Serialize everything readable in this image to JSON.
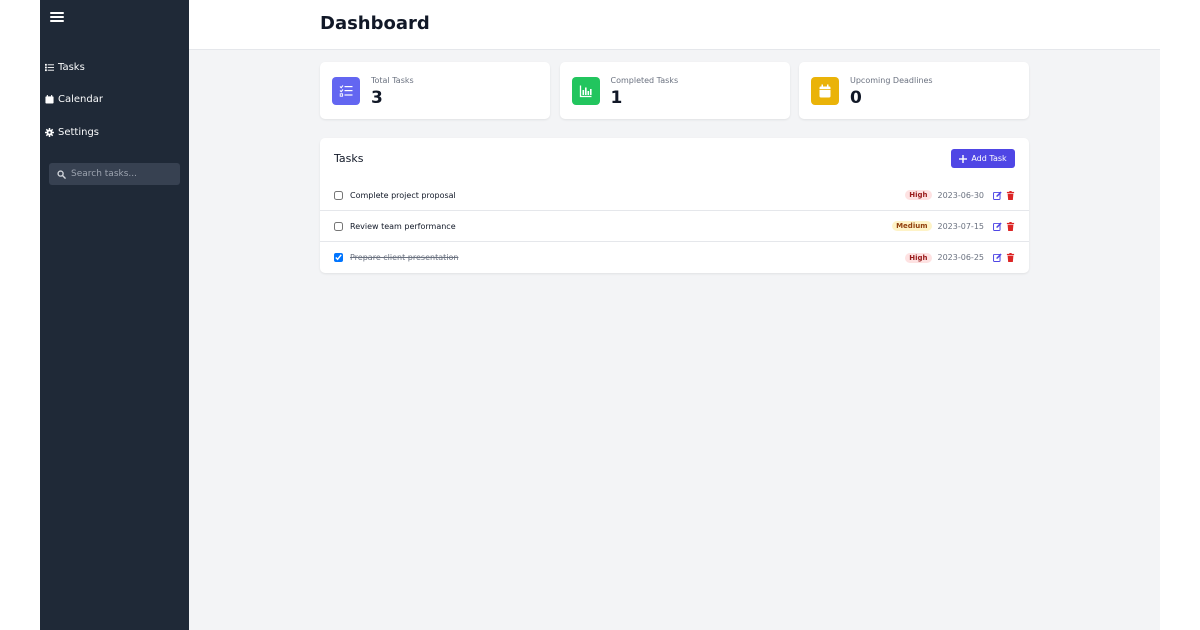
{
  "header": {
    "title": "Dashboard"
  },
  "sidebar": {
    "items": [
      {
        "label": "Tasks",
        "icon": "list-check-icon"
      },
      {
        "label": "Calendar",
        "icon": "calendar-icon"
      },
      {
        "label": "Settings",
        "icon": "gear-icon"
      }
    ],
    "search": {
      "placeholder": "Search tasks..."
    }
  },
  "stats": [
    {
      "label": "Total Tasks",
      "value": "3",
      "icon": "list-check-icon",
      "color": "#6366f1"
    },
    {
      "label": "Completed Tasks",
      "value": "1",
      "icon": "chart-bar-icon",
      "color": "#22c55e"
    },
    {
      "label": "Upcoming Deadlines",
      "value": "0",
      "icon": "calendar-icon",
      "color": "#eab308"
    }
  ],
  "tasks": {
    "title": "Tasks",
    "add_label": "Add Task",
    "items": [
      {
        "name": "Complete project proposal",
        "priority": "High",
        "due": "2023-06-30",
        "completed": false
      },
      {
        "name": "Review team performance",
        "priority": "Medium",
        "due": "2023-07-15",
        "completed": false
      },
      {
        "name": "Prepare client presentation",
        "priority": "High",
        "due": "2023-06-25",
        "completed": true
      }
    ]
  },
  "colors": {
    "sidebar_bg": "#1f2937",
    "accent": "#4f46e5",
    "edit": "#4f46e5",
    "delete": "#dc2626"
  }
}
